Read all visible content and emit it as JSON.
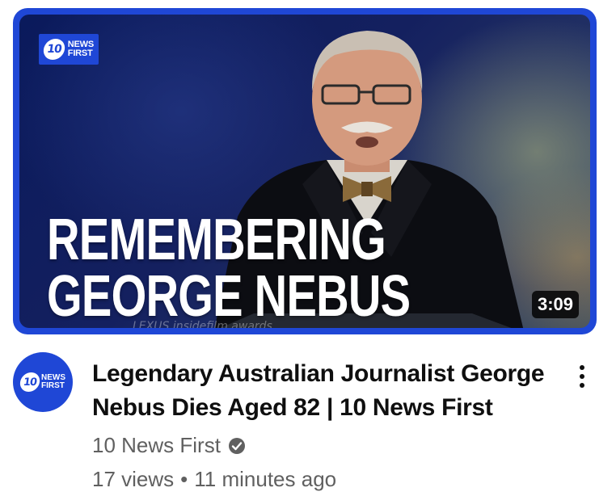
{
  "thumbnail": {
    "logo": {
      "number": "10",
      "line1": "NEWS",
      "line2": "FIRST"
    },
    "headline_line1": "REMEMBERING",
    "headline_line2": "GEORGE NEBUS",
    "podium_text": "LEXUS   insidefilm awards",
    "duration": "3:09",
    "frame_color": "#1f47d6"
  },
  "channel_avatar": {
    "number": "10",
    "line1": "NEWS",
    "line2": "FIRST"
  },
  "video": {
    "title": "Legendary Australian Journalist George Nebus Dies Aged 82 | 10 News First",
    "channel_name": "10 News First",
    "verified_icon": "verified-checkmark-icon",
    "views": "17 views",
    "separator": "•",
    "age": "11 minutes ago"
  },
  "menu_icon": "more-vert-icon"
}
